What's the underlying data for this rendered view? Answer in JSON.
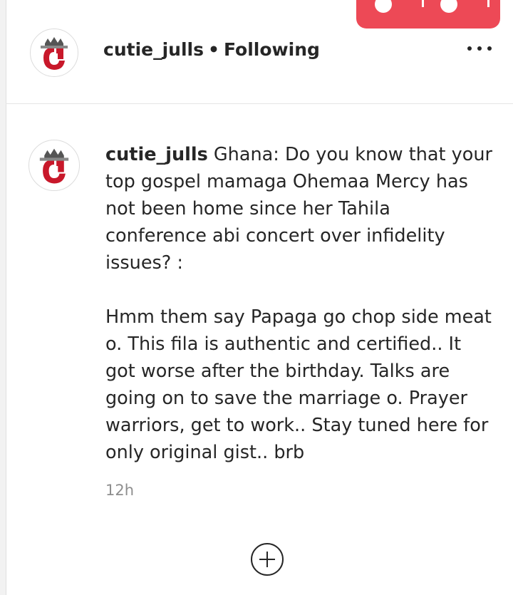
{
  "header": {
    "username": "cutie_julls",
    "separator": "•",
    "follow_status": "Following",
    "more_icon": "more-options-icon"
  },
  "post": {
    "username": "cutie_julls",
    "caption_line1": "Ghana: Do you know that your top gospel mamaga Ohemaa Mercy has not been home since her Tahila conference abi concert over infidelity issues? :",
    "caption_line2": "Hmm them say Papaga go chop side meat o. This fila is authentic and certified.. It got worse after the birthday. Talks are going on to save the marriage o. Prayer warriors, get to work.. Stay tuned here for only original gist.. brb",
    "timestamp": "12h"
  },
  "actions": {
    "load_more_icon": "plus-circle-icon"
  },
  "colors": {
    "accent": "#ed4956",
    "text": "#262626",
    "muted": "#8e8e8e"
  }
}
